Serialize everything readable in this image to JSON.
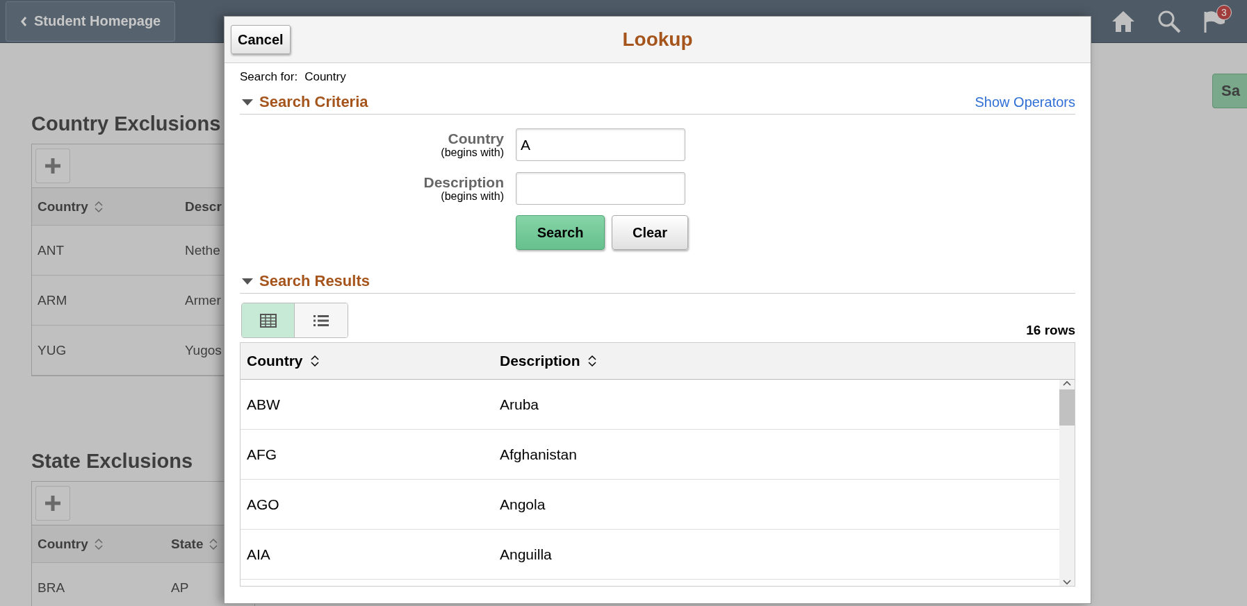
{
  "header": {
    "back_button": "Student Homepage",
    "notification_count": "3"
  },
  "save_button": "Sa",
  "sections": [
    {
      "title": "Country Exclusions",
      "columns": [
        "Country",
        "Descr"
      ],
      "rows": [
        [
          "ANT",
          "Nethe"
        ],
        [
          "ARM",
          "Armer"
        ],
        [
          "YUG",
          "Yugos"
        ]
      ]
    },
    {
      "title": "State Exclusions",
      "columns": [
        "Country",
        "State"
      ],
      "rows": [
        [
          "BRA",
          "AP"
        ]
      ]
    }
  ],
  "lookup": {
    "cancel_button": "Cancel",
    "title": "Lookup",
    "search_for_label": "Search for:",
    "search_for_value": "Country",
    "criteria": {
      "title": "Search Criteria",
      "expanded": true,
      "show_operators": "Show Operators",
      "fields": [
        {
          "label": "Country",
          "hint": "(begins with)",
          "value": "A"
        },
        {
          "label": "Description",
          "hint": "(begins with)"
        }
      ],
      "search_button": "Search",
      "clear_button": "Clear"
    },
    "results": {
      "title": "Search Results",
      "expanded": true,
      "views": [
        {
          "kind": "grid",
          "selected": true
        },
        {
          "kind": "list",
          "selected": false
        }
      ],
      "row_count": "16 rows",
      "columns": [
        "Country",
        "Description"
      ],
      "rows": [
        [
          "ABW",
          "Aruba"
        ],
        [
          "AFG",
          "Afghanistan"
        ],
        [
          "AGO",
          "Angola"
        ],
        [
          "AIA",
          "Anguilla"
        ]
      ]
    }
  }
}
